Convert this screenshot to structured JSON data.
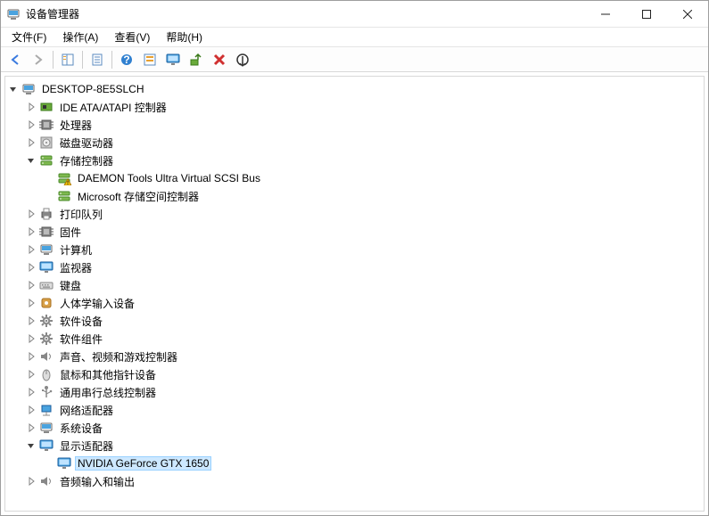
{
  "window": {
    "title": "设备管理器"
  },
  "menu": {
    "file": "文件(F)",
    "action": "操作(A)",
    "view": "查看(V)",
    "help": "帮助(H)"
  },
  "toolbar": {
    "back": "back",
    "forward": "forward",
    "showhide": "show-hide-pane",
    "props": "properties",
    "help": "help",
    "action": "action-center",
    "scan": "scan-hardware",
    "update": "update-driver",
    "uninstall": "uninstall",
    "refresh": "refresh"
  },
  "tree": {
    "root": {
      "label": "DESKTOP-8E5SLCH",
      "expanded": true
    },
    "nodes": [
      {
        "label": "IDE ATA/ATAPI 控制器",
        "icon": "ide",
        "expanded": false
      },
      {
        "label": "处理器",
        "icon": "cpu",
        "expanded": false
      },
      {
        "label": "磁盘驱动器",
        "icon": "disk",
        "expanded": false
      },
      {
        "label": "存储控制器",
        "icon": "storage",
        "expanded": true,
        "children": [
          {
            "label": "DAEMON Tools Ultra Virtual SCSI Bus",
            "icon": "storage-warn"
          },
          {
            "label": "Microsoft 存储空间控制器",
            "icon": "storage"
          }
        ]
      },
      {
        "label": "打印队列",
        "icon": "printer",
        "expanded": false
      },
      {
        "label": "固件",
        "icon": "firmware",
        "expanded": false
      },
      {
        "label": "计算机",
        "icon": "computer",
        "expanded": false
      },
      {
        "label": "监视器",
        "icon": "monitor",
        "expanded": false
      },
      {
        "label": "键盘",
        "icon": "keyboard",
        "expanded": false
      },
      {
        "label": "人体学输入设备",
        "icon": "hid",
        "expanded": false
      },
      {
        "label": "软件设备",
        "icon": "software",
        "expanded": false
      },
      {
        "label": "软件组件",
        "icon": "component",
        "expanded": false
      },
      {
        "label": "声音、视频和游戏控制器",
        "icon": "sound",
        "expanded": false
      },
      {
        "label": "鼠标和其他指针设备",
        "icon": "mouse",
        "expanded": false
      },
      {
        "label": "通用串行总线控制器",
        "icon": "usb",
        "expanded": false
      },
      {
        "label": "网络适配器",
        "icon": "network",
        "expanded": false
      },
      {
        "label": "系统设备",
        "icon": "system",
        "expanded": false
      },
      {
        "label": "显示适配器",
        "icon": "display",
        "expanded": true,
        "children": [
          {
            "label": "NVIDIA GeForce GTX 1650",
            "icon": "display",
            "selected": true
          }
        ]
      },
      {
        "label": "音频输入和输出",
        "icon": "audio",
        "expanded": false
      }
    ]
  }
}
